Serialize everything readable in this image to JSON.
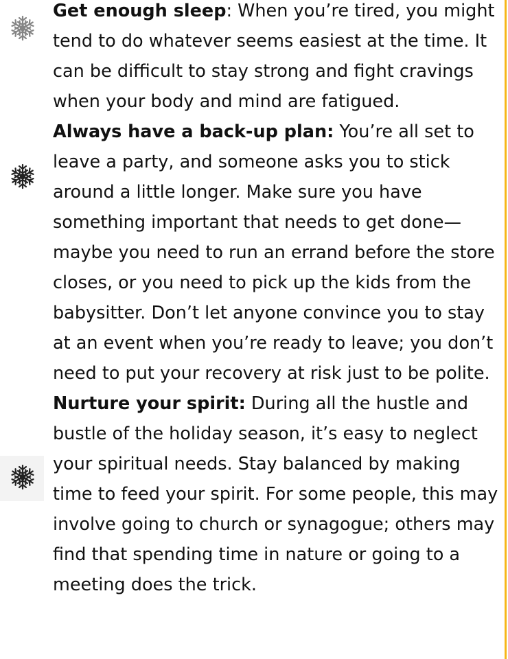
{
  "tips": [
    {
      "icon": "snowflake-icon",
      "title": "Get enough sleep",
      "body": ": When you’re tired, you might tend to do whatever seems easiest at the time. It can be difficult to stay strong and fight cravings when your body and mind are fatigued."
    },
    {
      "icon": "snowflake-icon",
      "title": "Always have a back-up plan:",
      "body": " You’re all set to leave a party, and someone asks you to stick around a little longer. Make sure you have something important that needs to get done—maybe you need to run an errand before the store closes, or you need to pick up the kids from the babysitter. Don’t let anyone convince you to stay at an event when you’re ready to leave; you don’t need to put your recovery at risk just to be polite."
    },
    {
      "icon": "snowflake-icon",
      "title": "Nurture your spirit:",
      "body": " During all the hustle and bustle of the holiday season, it’s easy to neglect your spiritual needs. Stay balanced by making time to feed your spirit. For some people, this may involve going to church or synagogue; others may find that spending time in nature or going to a meeting does the trick."
    }
  ],
  "colors": {
    "accent_rule": "#f6b71a",
    "text": "#111111",
    "icon": "#222222"
  }
}
